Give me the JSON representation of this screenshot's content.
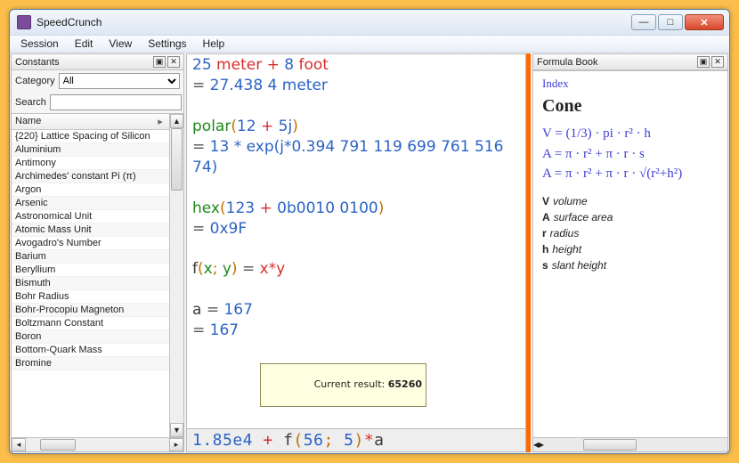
{
  "window": {
    "title": "SpeedCrunch"
  },
  "menu": {
    "session": "Session",
    "edit": "Edit",
    "view": "View",
    "settings": "Settings",
    "help": "Help"
  },
  "constants_panel": {
    "title": "Constants",
    "category_label": "Category",
    "category_value": "All",
    "search_label": "Search",
    "search_value": "",
    "header_name": "Name",
    "items": [
      "{220} Lattice Spacing of Silicon",
      "Aluminium",
      "Antimony",
      "Archimedes' constant Pi (π)",
      "Argon",
      "Arsenic",
      "Astronomical Unit",
      "Atomic Mass Unit",
      "Avogadro's Number",
      "Barium",
      "Beryllium",
      "Bismuth",
      "Bohr Radius",
      "Bohr-Procopiu Magneton",
      "Boltzmann Constant",
      "Boron",
      "Bottom-Quark Mass",
      "Bromine"
    ]
  },
  "history": {
    "l1_a": "25",
    "l1_b": "meter",
    "l1_c": "+",
    "l1_d": "8",
    "l1_e": "foot",
    "l2_a": "=",
    "l2_b": "27.438 4 meter",
    "l3_a": "polar",
    "l3_b": "(",
    "l3_c": "12",
    "l3_d": "+",
    "l3_e": "5j",
    "l3_f": ")",
    "l4_a": "=",
    "l4_b": "13 * exp(j*0.394 791 119 699 761 516 74)",
    "l5_a": "hex",
    "l5_b": "(",
    "l5_c": "123",
    "l5_d": "+",
    "l5_e": "0b0010 0100",
    "l5_f": ")",
    "l6_a": "=",
    "l6_b": "0x9F",
    "l7_a": "f",
    "l7_b": "(",
    "l7_c": "x",
    "l7_d": ";",
    "l7_e": "y",
    "l7_f": ")",
    "l7_g": "=",
    "l7_h": "x",
    "l7_i": "*",
    "l7_j": "y",
    "l8_a": "a",
    "l8_b": "=",
    "l8_c": "167",
    "l9_a": "=",
    "l9_b": "167",
    "tip_label": "Current result:",
    "tip_value": "65260"
  },
  "input": {
    "t1": "1.85e4",
    "t2": "+",
    "t3": "f",
    "t4": "(",
    "t5": "56",
    "t6": ";",
    "t7": "5",
    "t8": ")",
    "t9": "*",
    "t10": "a"
  },
  "formula_panel": {
    "title": "Formula Book",
    "index": "Index",
    "heading": "Cone",
    "formulas": {
      "f1": "V = (1/3) · pi · r² · h",
      "f2": "A = π · r² + π · r · s",
      "f3": "A = π · r² + π · r · √(r²+h²)"
    },
    "legend": {
      "v_sym": "V",
      "v_txt": "volume",
      "a_sym": "A",
      "a_txt": "surface area",
      "r_sym": "r",
      "r_txt": "radius",
      "h_sym": "h",
      "h_txt": "height",
      "s_sym": "s",
      "s_txt": "slant height"
    }
  }
}
